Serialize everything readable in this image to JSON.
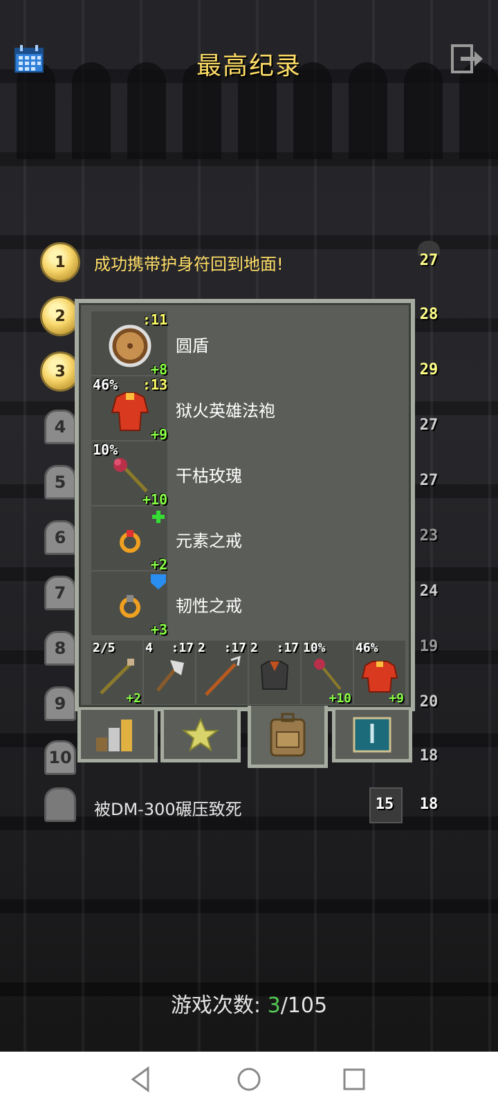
{
  "header": {
    "title": "最高纪录"
  },
  "records": [
    {
      "rank": "1",
      "text": "成功携带护身符回到地面!",
      "level": "27",
      "level_color": "#ffff88",
      "style": "medal"
    },
    {
      "rank": "2",
      "text": "",
      "level": "28",
      "level_color": "#ffff88",
      "style": "medal"
    },
    {
      "rank": "3",
      "text": "",
      "level": "29",
      "level_color": "#ffff88",
      "style": "medal"
    },
    {
      "rank": "4",
      "level": "27",
      "level_color": "#cfcfcf",
      "style": "tomb"
    },
    {
      "rank": "5",
      "level": "27",
      "level_color": "#cfcfcf",
      "style": "tomb"
    },
    {
      "rank": "6",
      "level": "23",
      "level_color": "#9a9a9a",
      "style": "tomb"
    },
    {
      "rank": "7",
      "level": "24",
      "level_color": "#cfcfcf",
      "style": "tomb"
    },
    {
      "rank": "8",
      "level": "19",
      "level_color": "#9a9a9a",
      "style": "tomb"
    },
    {
      "rank": "9",
      "level": "20",
      "level_color": "#cfcfcf",
      "style": "tomb"
    },
    {
      "rank": "10",
      "level": "18",
      "level_color": "#cfcfcf",
      "style": "tomb"
    }
  ],
  "defeat": {
    "text": "被DM-300碾压致死",
    "depth": "15",
    "level": "18"
  },
  "panel": {
    "items": [
      {
        "name": "圆盾",
        "top_right": ":11",
        "top_left": "",
        "bottom": "+8"
      },
      {
        "name": "狱火英雄法袍",
        "top_right": ":13",
        "top_left": "46%",
        "bottom": "+9"
      },
      {
        "name": "干枯玫瑰",
        "top_right": "",
        "top_left": "10%",
        "bottom": "+10"
      },
      {
        "name": "元素之戒",
        "top_right": "",
        "top_left": "",
        "bottom": "+2"
      },
      {
        "name": "韧性之戒",
        "top_right": "",
        "top_left": "",
        "bottom": "+3"
      }
    ],
    "quickslots": [
      {
        "tl": "2/5",
        "tr": "",
        "bottom": "+2"
      },
      {
        "tl": "4",
        "tr": ":17",
        "bottom": ""
      },
      {
        "tl": "2",
        "tr": ":17",
        "bottom": ""
      },
      {
        "tl": "2",
        "tr": ":17",
        "bottom": ""
      },
      {
        "tl": "10%",
        "tr": "",
        "bottom": "+10"
      },
      {
        "tl": "46%",
        "tr": "",
        "bottom": "+9"
      }
    ]
  },
  "footer": {
    "label": "游戏次数:",
    "current": "3",
    "total": "/105"
  }
}
